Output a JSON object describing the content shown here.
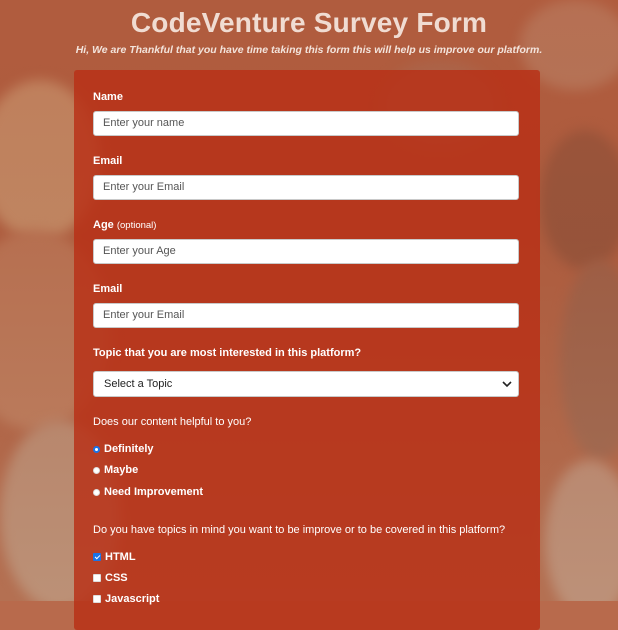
{
  "header": {
    "title": "CodeVenture Survey Form",
    "subtitle": "Hi, We are Thankful that you have time taking this form this will help us improve our platform."
  },
  "form": {
    "name": {
      "label": "Name",
      "placeholder": "Enter your name"
    },
    "email": {
      "label": "Email",
      "placeholder": "Enter your Email"
    },
    "age": {
      "label": "Age",
      "optional": "(optional)",
      "placeholder": "Enter your Age"
    },
    "email2": {
      "label": "Email",
      "placeholder": "Enter your Email"
    },
    "topic": {
      "label": "Topic that you are most interested in this platform?",
      "selected": "Select a Topic"
    },
    "helpful": {
      "question": "Does our content helpful to you?",
      "options": [
        {
          "label": "Definitely",
          "checked": true
        },
        {
          "label": "Maybe",
          "checked": false
        },
        {
          "label": "Need Improvement",
          "checked": false
        }
      ]
    },
    "topics_in_mind": {
      "question": "Do you have topics in mind you want to be improve or to be covered in this platform?",
      "options": [
        {
          "label": "HTML",
          "checked": true
        },
        {
          "label": "CSS",
          "checked": false
        },
        {
          "label": "Javascript",
          "checked": false
        }
      ]
    }
  },
  "colors": {
    "form_bg": "#b83016",
    "accent": "#1a73e8"
  },
  "icons": {
    "select_chevron": "chevron-down-icon"
  }
}
